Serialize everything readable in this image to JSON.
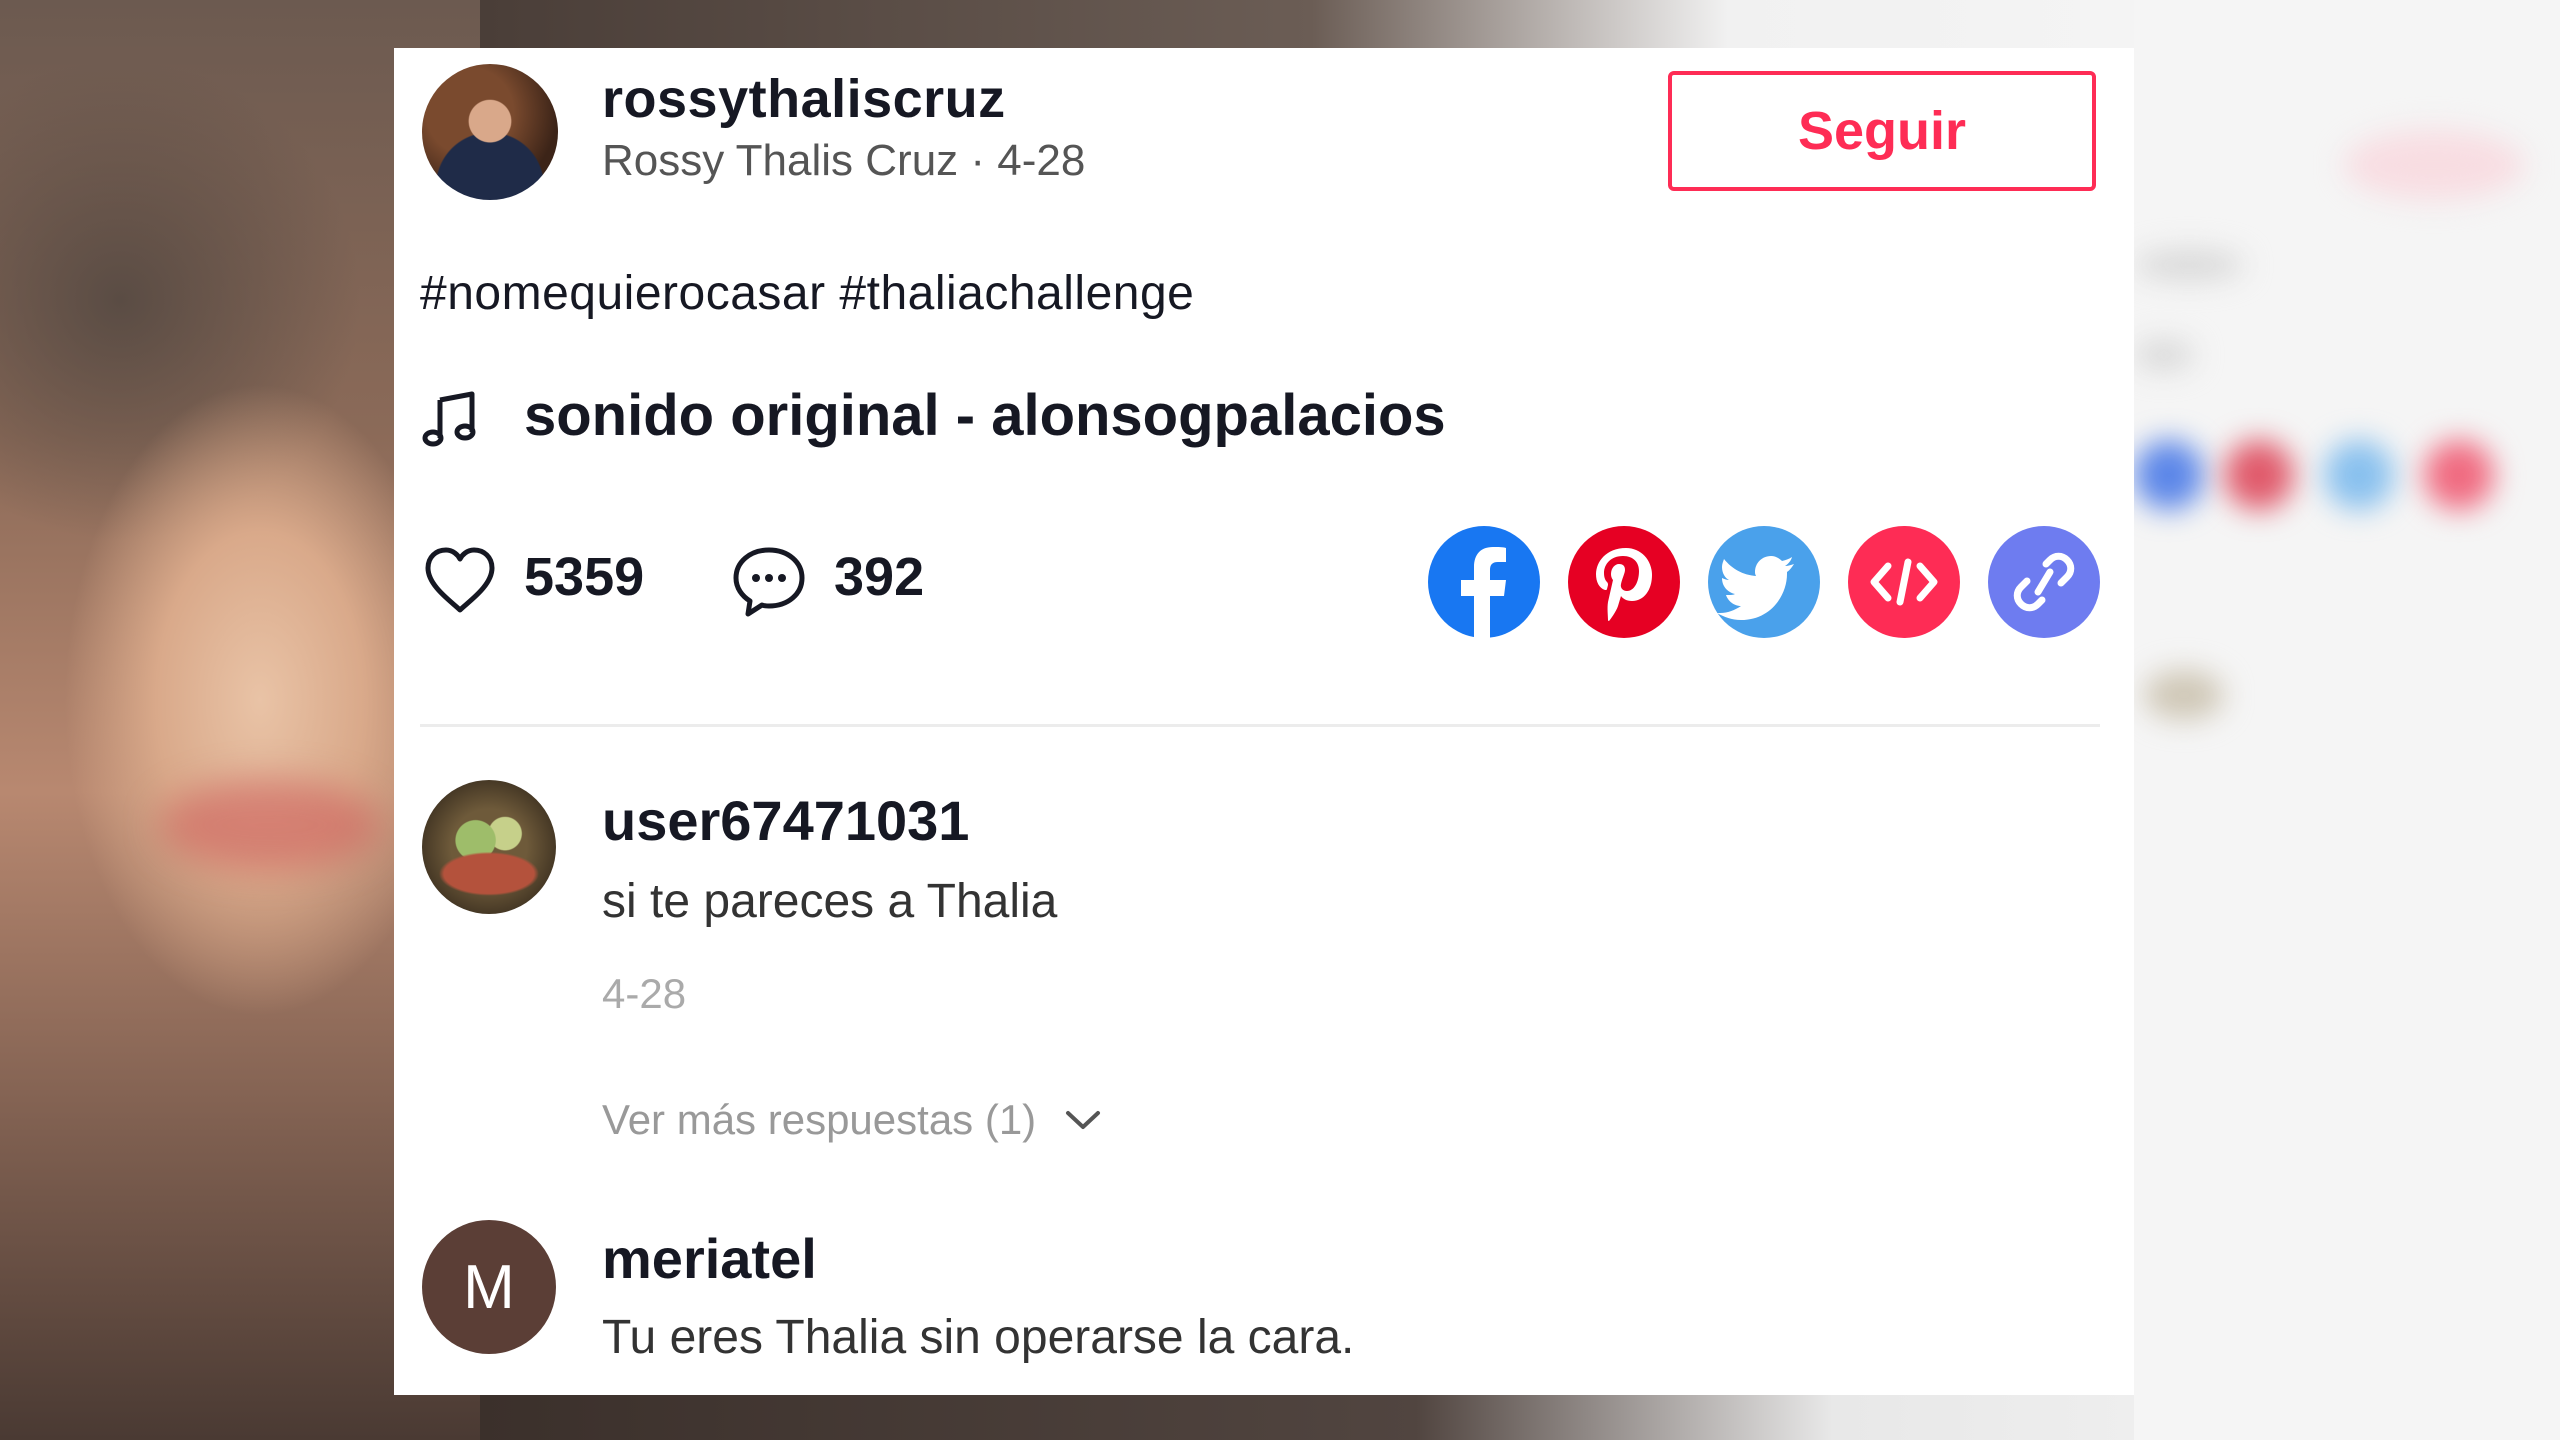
{
  "post": {
    "username": "rossythaliscruz",
    "display_name_date": "Rossy Thalis Cruz · 4-28",
    "follow_label": "Seguir",
    "hashtags": "#nomequierocasar #thaliachallenge",
    "sound": "sonido original - alonsogpalacios",
    "likes": "5359",
    "comments": "392"
  },
  "share_icons": [
    "facebook-icon",
    "pinterest-icon",
    "twitter-icon",
    "embed-icon",
    "link-icon"
  ],
  "colors": {
    "accent": "#fe2c55",
    "facebook": "#1877f2",
    "pinterest": "#e60023",
    "twitter": "#4aa1eb",
    "embed": "#fe2c55",
    "link": "#6e7cf0"
  },
  "comments": [
    {
      "username": "user67471031",
      "text": "si te pareces a Thalia",
      "date": "4-28",
      "more_replies": "Ver más respuestas (1)"
    },
    {
      "username": "meriatel",
      "avatar_letter": "M",
      "text": "Tu eres Thalia sin operarse la cara."
    }
  ]
}
